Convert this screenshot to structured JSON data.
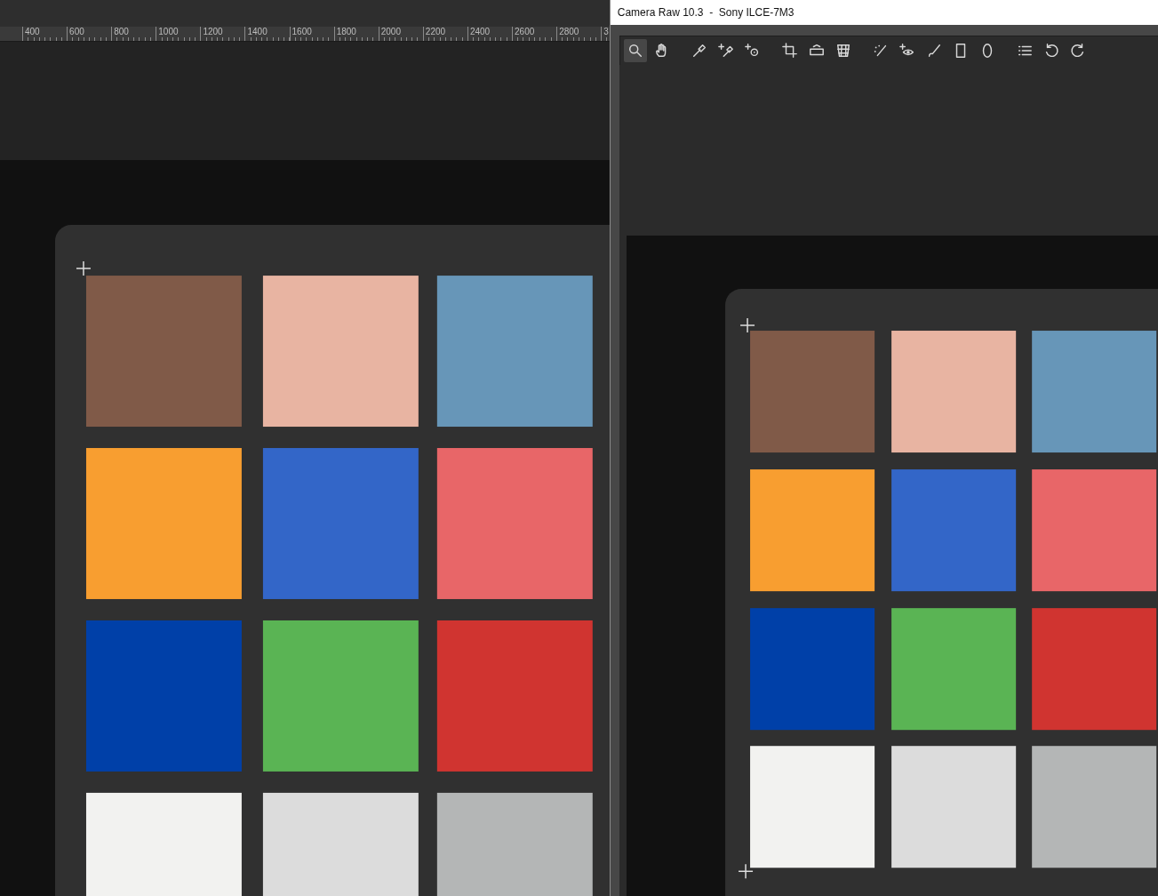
{
  "ruler": {
    "labels": [
      "400",
      "600",
      "800",
      "1000",
      "1200",
      "1400",
      "1600",
      "1800",
      "2000",
      "2200",
      "2400",
      "2600",
      "2800",
      "3"
    ]
  },
  "camera_raw": {
    "window": {
      "title": "Camera Raw 10.3  -  Sony ILCE-7M3"
    },
    "tools": [
      {
        "kind": "zoom",
        "selected": true
      },
      {
        "kind": "hand",
        "selected": false
      },
      {
        "kind": "gap"
      },
      {
        "kind": "eyedropper",
        "selected": false
      },
      {
        "kind": "sampler",
        "selected": false
      },
      {
        "kind": "target",
        "selected": false
      },
      {
        "kind": "gap"
      },
      {
        "kind": "crop",
        "selected": false
      },
      {
        "kind": "straighten",
        "selected": false
      },
      {
        "kind": "transform",
        "selected": false
      },
      {
        "kind": "gap"
      },
      {
        "kind": "spot",
        "selected": false
      },
      {
        "kind": "redeye",
        "selected": false
      },
      {
        "kind": "brush",
        "selected": false
      },
      {
        "kind": "gradient",
        "selected": false
      },
      {
        "kind": "radial",
        "selected": false
      },
      {
        "kind": "gap"
      },
      {
        "kind": "list",
        "selected": false
      },
      {
        "kind": "rotleft",
        "selected": false
      },
      {
        "kind": "rotright",
        "selected": false
      }
    ]
  }
}
